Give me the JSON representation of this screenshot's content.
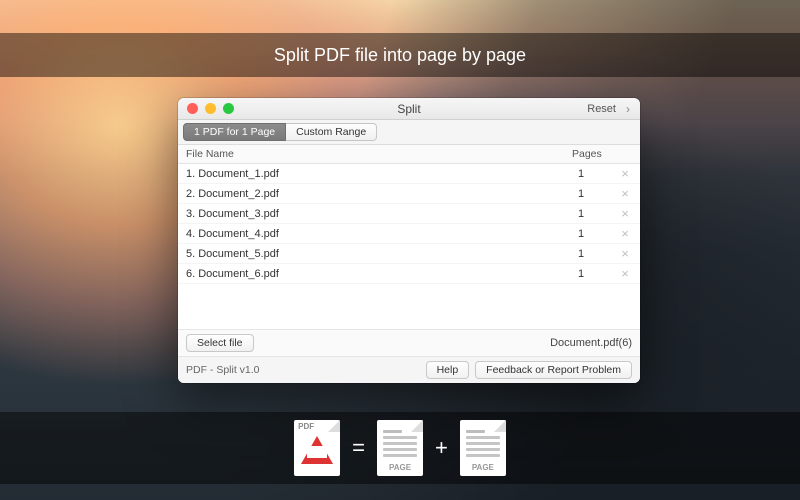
{
  "banner_top": "Split PDF file into page by page",
  "window": {
    "title": "Split",
    "reset": "Reset",
    "tabs": {
      "active": "1 PDF for 1 Page",
      "other": "Custom Range"
    },
    "columns": {
      "filename": "File Name",
      "pages": "Pages"
    },
    "rows": [
      {
        "name": "1. Document_1.pdf",
        "pages": "1"
      },
      {
        "name": "2. Document_2.pdf",
        "pages": "1"
      },
      {
        "name": "3. Document_3.pdf",
        "pages": "1"
      },
      {
        "name": "4. Document_4.pdf",
        "pages": "1"
      },
      {
        "name": "5. Document_5.pdf",
        "pages": "1"
      },
      {
        "name": "6. Document_6.pdf",
        "pages": "1"
      }
    ],
    "select_file": "Select file",
    "source_doc": "Document.pdf(6)",
    "version": "PDF - Split v1.0",
    "help": "Help",
    "feedback": "Feedback or Report Problem"
  },
  "illustration": {
    "pdf_label": "PDF",
    "page_label": "PAGE",
    "equals": "=",
    "plus": "+"
  }
}
